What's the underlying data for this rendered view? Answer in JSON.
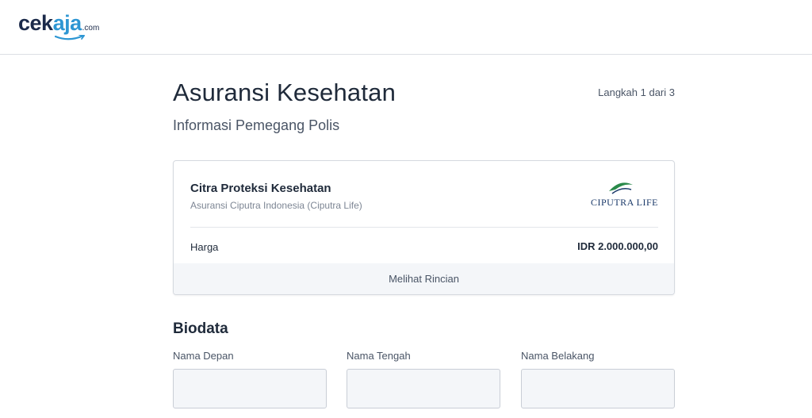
{
  "brand": {
    "name_main": "cek",
    "name_accent": "aja",
    "name_suffix": ".com",
    "main_color": "#1b2a4a",
    "accent_color": "#2d96d3"
  },
  "page": {
    "title": "Asuransi Kesehatan",
    "subtitle": "Informasi Pemegang Polis",
    "step": "Langkah 1 dari 3"
  },
  "product_card": {
    "product_name": "Citra Proteksi Kesehatan",
    "insurer": "Asuransi Ciputra Indonesia (Ciputra Life)",
    "partner_logo_text": "CIPUTRA LIFE",
    "price_label": "Harga",
    "price_value": "IDR 2.000.000,00",
    "details_label": "Melihat Rincian"
  },
  "biodata": {
    "section_title": "Biodata",
    "fields": [
      {
        "label": "Nama Depan",
        "value": "",
        "placeholder": ""
      },
      {
        "label": "Nama Tengah",
        "value": "",
        "placeholder": ""
      },
      {
        "label": "Nama Belakang",
        "value": "",
        "placeholder": ""
      }
    ]
  }
}
